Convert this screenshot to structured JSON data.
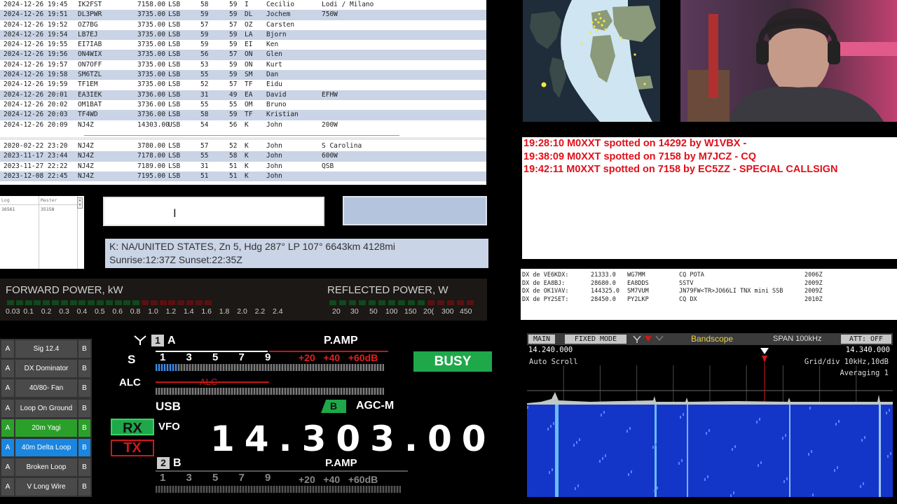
{
  "log": {
    "rows": [
      {
        "dt": "2024-12-26 19:45",
        "call": "IK2FST",
        "freq": "7158.00",
        "mode": "LSB",
        "rs": "58",
        "rr": "59",
        "pfx": "I",
        "name": "Cecilio",
        "note": "Lodi / Milano",
        "alt": false
      },
      {
        "dt": "2024-12-26 19:51",
        "call": "DL3PWR",
        "freq": "3735.00",
        "mode": "LSB",
        "rs": "59",
        "rr": "59",
        "pfx": "DL",
        "name": "Jochem",
        "note": "750W",
        "alt": true
      },
      {
        "dt": "2024-12-26 19:52",
        "call": "OZ7BG",
        "freq": "3735.00",
        "mode": "LSB",
        "rs": "57",
        "rr": "57",
        "pfx": "OZ",
        "name": "Carsten",
        "note": "",
        "alt": false
      },
      {
        "dt": "2024-12-26 19:54",
        "call": "LB7EJ",
        "freq": "3735.00",
        "mode": "LSB",
        "rs": "59",
        "rr": "59",
        "pfx": "LA",
        "name": "Bjorn",
        "note": "",
        "alt": true
      },
      {
        "dt": "2024-12-26 19:55",
        "call": "EI7IAB",
        "freq": "3735.00",
        "mode": "LSB",
        "rs": "59",
        "rr": "59",
        "pfx": "EI",
        "name": "Ken",
        "note": "",
        "alt": false
      },
      {
        "dt": "2024-12-26 19:56",
        "call": "ON4WIX",
        "freq": "3735.00",
        "mode": "LSB",
        "rs": "56",
        "rr": "57",
        "pfx": "ON",
        "name": "Glen",
        "note": "",
        "alt": true
      },
      {
        "dt": "2024-12-26 19:57",
        "call": "ON7OFF",
        "freq": "3735.00",
        "mode": "LSB",
        "rs": "53",
        "rr": "59",
        "pfx": "ON",
        "name": "Kurt",
        "note": "",
        "alt": false
      },
      {
        "dt": "2024-12-26 19:58",
        "call": "SM6TZL",
        "freq": "3735.00",
        "mode": "LSB",
        "rs": "55",
        "rr": "59",
        "pfx": "SM",
        "name": "Dan",
        "note": "",
        "alt": true
      },
      {
        "dt": "2024-12-26 19:59",
        "call": "TF1EM",
        "freq": "3735.00",
        "mode": "LSB",
        "rs": "52",
        "rr": "57",
        "pfx": "TF",
        "name": "Eidu",
        "note": "",
        "alt": false
      },
      {
        "dt": "2024-12-26 20:01",
        "call": "EA3IEK",
        "freq": "3736.00",
        "mode": "LSB",
        "rs": "31",
        "rr": "49",
        "pfx": "EA",
        "name": "David",
        "note": "EFHW",
        "alt": true
      },
      {
        "dt": "2024-12-26 20:02",
        "call": "OM1BAT",
        "freq": "3736.00",
        "mode": "LSB",
        "rs": "55",
        "rr": "55",
        "pfx": "OM",
        "name": "Bruno",
        "note": "",
        "alt": false
      },
      {
        "dt": "2024-12-26 20:03",
        "call": "TF4WD",
        "freq": "3736.00",
        "mode": "LSB",
        "rs": "58",
        "rr": "59",
        "pfx": "TF",
        "name": "Kristian",
        "note": "",
        "alt": true
      },
      {
        "dt": "2024-12-26 20:09",
        "call": "NJ4Z",
        "freq": "14303.00",
        "mode": "USB",
        "rs": "54",
        "rr": "56",
        "pfx": "K",
        "name": "John",
        "note": "200W",
        "alt": false
      }
    ],
    "history": [
      {
        "dt": "2020-02-22 23:20",
        "call": "NJ4Z",
        "freq": "3780.00",
        "mode": "LSB",
        "rs": "57",
        "rr": "52",
        "pfx": "K",
        "name": "John",
        "note": "S Carolina",
        "alt": false
      },
      {
        "dt": "2023-11-17 23:44",
        "call": "NJ4Z",
        "freq": "7178.00",
        "mode": "LSB",
        "rs": "55",
        "rr": "58",
        "pfx": "K",
        "name": "John",
        "note": "600W",
        "alt": true
      },
      {
        "dt": "2023-11-27 22:22",
        "call": "NJ4Z",
        "freq": "7189.00",
        "mode": "LSB",
        "rs": "31",
        "rr": "51",
        "pfx": "K",
        "name": "John",
        "note": "QSB",
        "alt": false
      },
      {
        "dt": "2023-12-08 22:45",
        "call": "NJ4Z",
        "freq": "7195.00",
        "mode": "LSB",
        "rs": "51",
        "rr": "51",
        "pfx": "K",
        "name": "John",
        "note": "",
        "alt": true
      }
    ]
  },
  "counter": {
    "log_label": "Log",
    "log_value": "16561",
    "master_label": "Master",
    "master_value": "35158"
  },
  "geo": {
    "line1": "K: NA/UNITED STATES, Zn 5, Hdg 287° LP 107° 6643km 4128mi",
    "line2": "Sunrise:12:37Z Sunset:22:35Z"
  },
  "meter": {
    "fwd_title": "FORWARD POWER, kW",
    "ref_title": "REFLECTED POWER, W",
    "fwd_labels": [
      "0.03",
      "0.1",
      "0.2",
      "0.3",
      "0.4",
      "0.5",
      "0.6",
      "0.8",
      "1.0",
      "1.2",
      "1.4",
      "1.6",
      "1.8",
      "2.0",
      "2.2",
      "2.4"
    ],
    "ref_labels": [
      "20",
      "30",
      "50",
      "100",
      "150",
      "20(",
      "300",
      "450"
    ]
  },
  "antennas": [
    {
      "a": "A",
      "name": "Sig 12.4",
      "b": "B",
      "state": "normal"
    },
    {
      "a": "A",
      "name": "DX Dominator",
      "b": "B",
      "state": "normal"
    },
    {
      "a": "A",
      "name": "40/80- Fan",
      "b": "B",
      "state": "normal"
    },
    {
      "a": "A",
      "name": "Loop On Ground",
      "b": "B",
      "state": "normal"
    },
    {
      "a": "A",
      "name": "20m Yagi",
      "b": "B",
      "state": "green"
    },
    {
      "a": "A",
      "name": "40m Delta Loop",
      "b": "B",
      "state": "blue"
    },
    {
      "a": "A",
      "name": "Broken Loop",
      "b": "B",
      "state": "normal"
    },
    {
      "a": "A",
      "name": "V Long Wire",
      "b": "B",
      "state": "normal"
    }
  ],
  "radio": {
    "vfo_a_num": "1",
    "vfo_a_letter": "A",
    "pamp": "P.AMP",
    "s_label": "S",
    "s_scale": [
      "1",
      "3",
      "5",
      "7",
      "9"
    ],
    "s_plus": "+20   +40   +60dB",
    "busy": "BUSY",
    "alc_label": "ALC",
    "alc_inner": "ALC",
    "mode": "USB",
    "agc_letter": "B",
    "agc": "AGC-M",
    "rx": "RX",
    "tx": "TX",
    "vfo": "VFO",
    "frequency": "14.303.00",
    "vfo_b_num": "2",
    "vfo_b_letter": "B",
    "pamp_b": "P.AMP",
    "b_scale": [
      "1",
      "3",
      "5",
      "7",
      "9"
    ],
    "b_plus": "+20   +40   +60dB"
  },
  "spots": [
    "19:28:10 M0XXT spotted on 14292 by W1VBX -",
    "19:38:09 M0XXT spotted on 7158 by M7JCZ - CQ",
    "19:42:11 M0XXT spotted on 7158 by EC5ZZ - SPECIAL CALLSIGN"
  ],
  "dx": [
    {
      "de": "DX de VE6KDX:",
      "freq": "21333.0",
      "call": "WG7MM",
      "cmt": "CQ POTA",
      "time": "2006Z"
    },
    {
      "de": "DX de EA8BJ:",
      "freq": "28680.0",
      "call": "EA8DDS",
      "cmt": "SSTV",
      "time": "2009Z"
    },
    {
      "de": "DX de OK1VAV:",
      "freq": "144325.0",
      "call": "SM7VUM",
      "cmt": "JN79FW<TR>JO66LI TNX mini SSB",
      "time": "2009Z"
    },
    {
      "de": "DX de PY2SET:",
      "freq": "28450.0",
      "call": "PY2LKP",
      "cmt": "CQ DX",
      "time": "2010Z"
    }
  ],
  "scope": {
    "main": "MAIN",
    "fixed": "FIXED MODE",
    "title": "Bandscope",
    "span": "SPAN 100kHz",
    "att": "ATT: OFF",
    "f_left": "14.240.000",
    "f_right": "14.340.000",
    "auto": "Auto Scroll",
    "grid": "Grid/div 10kHz,10dB",
    "avg": "Averaging 1"
  }
}
